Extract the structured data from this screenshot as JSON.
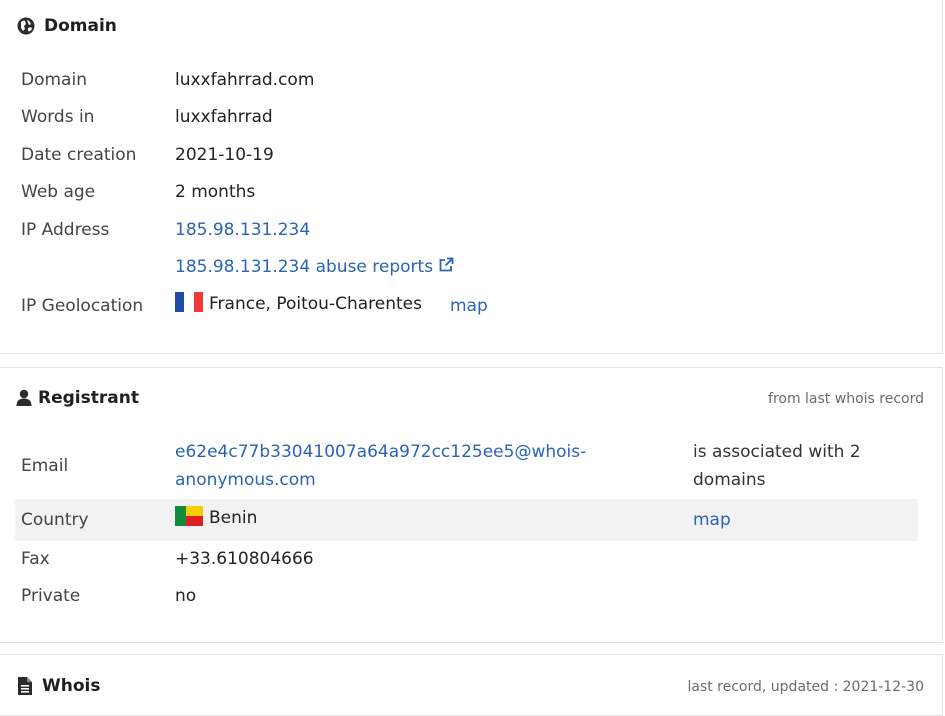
{
  "domain_card": {
    "title": "Domain",
    "icon": "globe-icon",
    "rows": {
      "domain": {
        "label": "Domain",
        "value": "luxxfahrrad.com"
      },
      "words": {
        "label": "Words in",
        "value": "luxxfahrrad"
      },
      "date_creation": {
        "label": "Date creation",
        "value": "2021-10-19"
      },
      "web_age": {
        "label": "Web age",
        "value": "2 months"
      },
      "ip": {
        "label": "IP Address",
        "value": "185.98.131.234"
      },
      "abuse": {
        "value": "185.98.131.234 abuse reports",
        "icon": "external-link-icon"
      },
      "geo": {
        "label": "IP Geolocation",
        "value": "France, Poitou-Charentes",
        "flag": "france-flag",
        "map_link": "map"
      }
    }
  },
  "registrant_card": {
    "title": "Registrant",
    "icon": "user-icon",
    "note": "from last whois record",
    "rows": {
      "email": {
        "label": "Email",
        "value_line1": "e62e4c77b33041007a64a972cc125ee5@whois-",
        "value_line2": "anonymous.com",
        "assoc_line1": "is associated with 2",
        "assoc_line2": "domains"
      },
      "country": {
        "label": "Country",
        "value": "Benin",
        "flag": "benin-flag",
        "map_link": "map"
      },
      "fax": {
        "label": "Fax",
        "value": "+33.610804666"
      },
      "private": {
        "label": "Private",
        "value": "no"
      }
    }
  },
  "whois_card": {
    "title": "Whois",
    "icon": "document-icon",
    "note": "last record, updated : 2021-12-30"
  },
  "colors": {
    "link": "#2a64b4",
    "label": "#444444",
    "shaded_row": "#f2f2f2",
    "france": [
      "#1f4aa6",
      "#ffffff",
      "#f03a3a"
    ],
    "benin": [
      "#108c3c",
      "#f5d000",
      "#e02020"
    ]
  }
}
